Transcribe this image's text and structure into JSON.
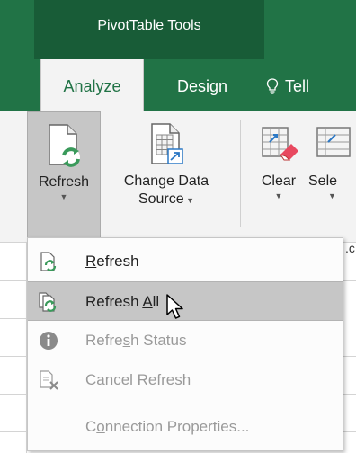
{
  "contextual_group": {
    "label": "PivotTable Tools"
  },
  "tabs": [
    {
      "label": "Analyze",
      "active": true
    },
    {
      "label": "Design",
      "active": false
    },
    {
      "label": "Tell",
      "active": false
    }
  ],
  "ribbon": {
    "refresh": {
      "label": "Refresh",
      "icon": "refresh-document-icon"
    },
    "change_data_source": {
      "line1": "Change Data",
      "line2": "Source",
      "icon": "change-data-source-icon"
    },
    "clear": {
      "label": "Clear",
      "icon": "clear-eraser-icon"
    },
    "select": {
      "label": "Sele",
      "icon": "select-icon"
    },
    "partial_label": ".c"
  },
  "menu": {
    "items": [
      {
        "prefix": "",
        "accel": "R",
        "suffix": "efresh",
        "icon": "refresh-icon",
        "enabled": true,
        "hovered": false
      },
      {
        "prefix": "Refresh ",
        "accel": "A",
        "suffix": "ll",
        "icon": "refresh-all-icon",
        "enabled": true,
        "hovered": true
      },
      {
        "prefix": "Refre",
        "accel": "s",
        "suffix": "h Status",
        "icon": "info-icon",
        "enabled": false,
        "hovered": false
      },
      {
        "prefix": "",
        "accel": "C",
        "suffix": "ancel Refresh",
        "icon": "cancel-refresh-icon",
        "enabled": false,
        "hovered": false
      },
      {
        "prefix": "C",
        "accel": "o",
        "suffix": "nnection Properties...",
        "icon": "",
        "enabled": false,
        "hovered": false
      }
    ]
  },
  "colors": {
    "excel_green": "#217346",
    "contextual_green": "#185c37",
    "ribbon_bg": "#f3f3f3",
    "hover_bg": "#c6c6c6",
    "refresh_green": "#3a9a5b"
  }
}
